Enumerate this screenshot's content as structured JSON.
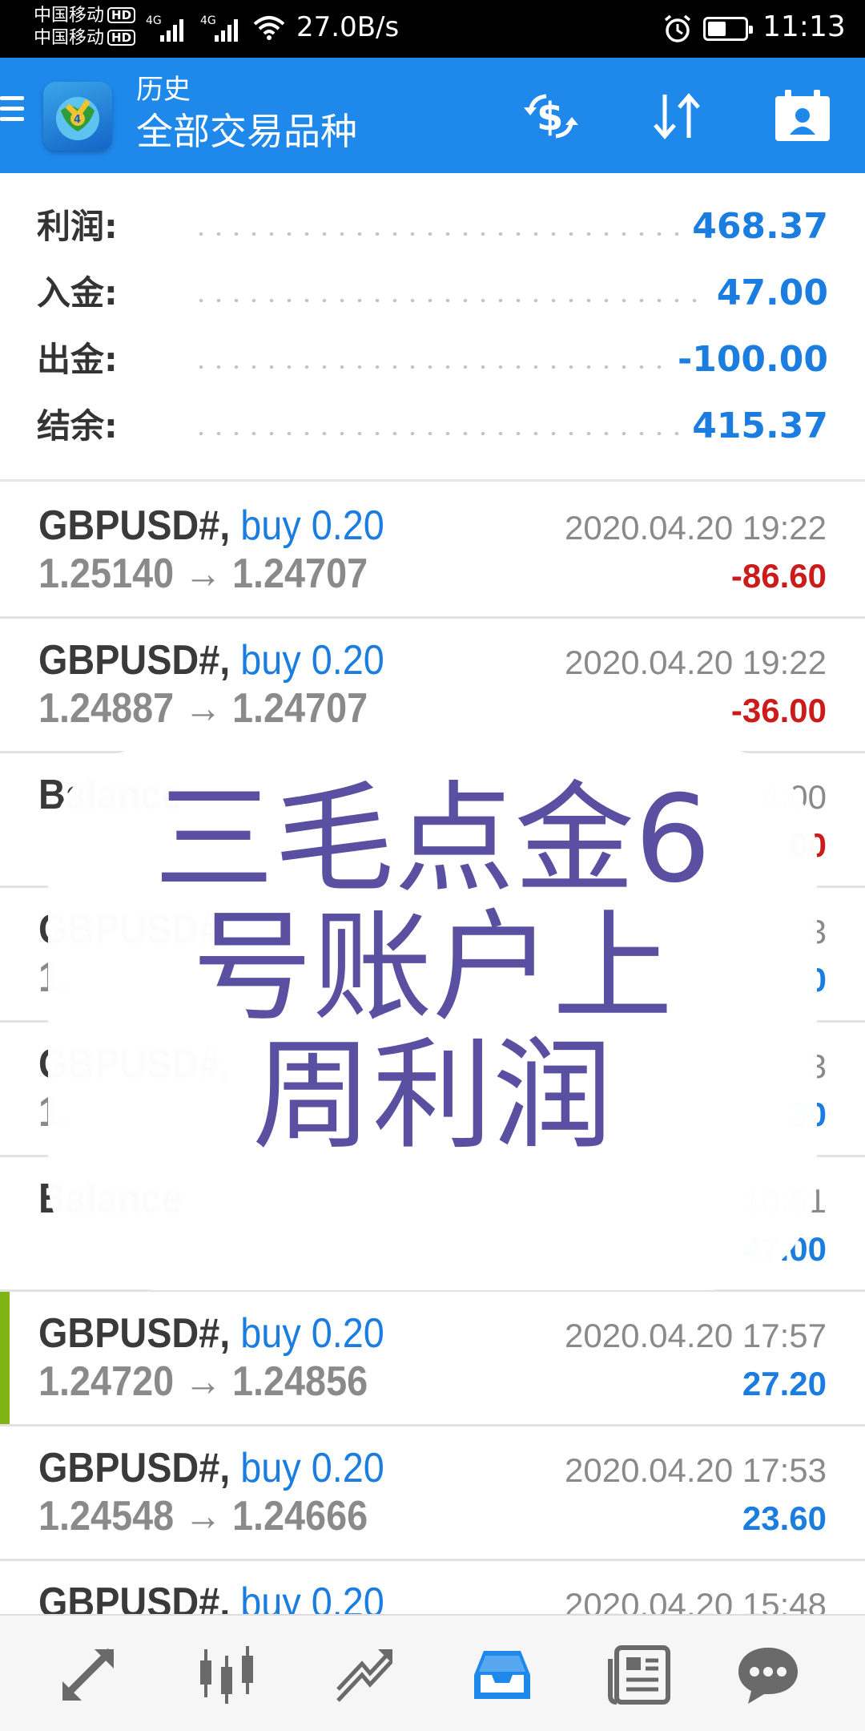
{
  "status_bar": {
    "carrier_1": "中国移动",
    "carrier_2": "中国移动",
    "hd_badge": "HD",
    "network_type": "4G",
    "net_speed": "27.0B/s",
    "time": "11:13",
    "battery_level": 0.55
  },
  "app_bar": {
    "subtitle": "历史",
    "title": "全部交易品种",
    "icons": [
      "menu-icon",
      "app-logo",
      "currency-exchange-icon",
      "sort-icon",
      "account-icon"
    ]
  },
  "summary": {
    "rows": [
      {
        "label": "利润:",
        "value": "468.37"
      },
      {
        "label": "入金:",
        "value": "47.00"
      },
      {
        "label": "出金:",
        "value": "-100.00"
      },
      {
        "label": "结余:",
        "value": "415.37"
      }
    ]
  },
  "deals": [
    {
      "symbol": "GBPUSD#, ",
      "side": "buy 0.20",
      "prices": "1.25140 → 1.24707",
      "time": "2020.04.20 19:22",
      "profit": "-86.60",
      "profit_sign": "negative"
    },
    {
      "symbol": "GBPUSD#, ",
      "side": "buy 0.20",
      "prices": "1.24887 → 1.24707",
      "time": "2020.04.20 19:22",
      "profit": "-36.00",
      "profit_sign": "negative"
    },
    {
      "symbol": "Balance",
      "side": "",
      "prices": "",
      "time": "4:00",
      "profit": "00",
      "profit_sign": "negative"
    },
    {
      "symbol": "GBPUSD#, ",
      "side": "",
      "prices": "1.",
      "time": "3",
      "profit": "0",
      "profit_sign": "positive"
    },
    {
      "symbol": "GBPUSD#, ",
      "side": "",
      "prices": "1.",
      "time": "3",
      "profit": "30",
      "profit_sign": "positive"
    },
    {
      "symbol": "Balance",
      "side": "",
      "prices": "",
      "time": "10:51",
      "profit": "47.00",
      "profit_sign": "positive"
    },
    {
      "symbol": "GBPUSD#, ",
      "side": "buy 0.20",
      "prices": "1.24720 → 1.24856",
      "time": "2020.04.20 17:57",
      "profit": "27.20",
      "profit_sign": "positive",
      "selected": true
    },
    {
      "symbol": "GBPUSD#, ",
      "side": "buy 0.20",
      "prices": "1.24548 → 1.24666",
      "time": "2020.04.20 17:53",
      "profit": "23.60",
      "profit_sign": "positive"
    },
    {
      "symbol": "GBPUSD#, ",
      "side": "buy 0.20",
      "prices": "",
      "time": "2020.04.20 15:48",
      "profit": "",
      "profit_sign": "positive"
    }
  ],
  "overlay_caption": "三毛点金6\n号账户上\n周利润",
  "bottom_nav": [
    {
      "name": "quotes-icon",
      "active": false
    },
    {
      "name": "chart-icon",
      "active": false
    },
    {
      "name": "trade-icon",
      "active": false
    },
    {
      "name": "history-icon",
      "active": true
    },
    {
      "name": "news-icon",
      "active": false
    },
    {
      "name": "messages-icon",
      "active": false
    }
  ],
  "colors": {
    "app_bar": "#1f88eb",
    "accent_blue": "#1a7ddf",
    "loss_red": "#cc1b1b",
    "selected_marker": "#7fb414",
    "overlay_text": "#5a4fa0"
  }
}
